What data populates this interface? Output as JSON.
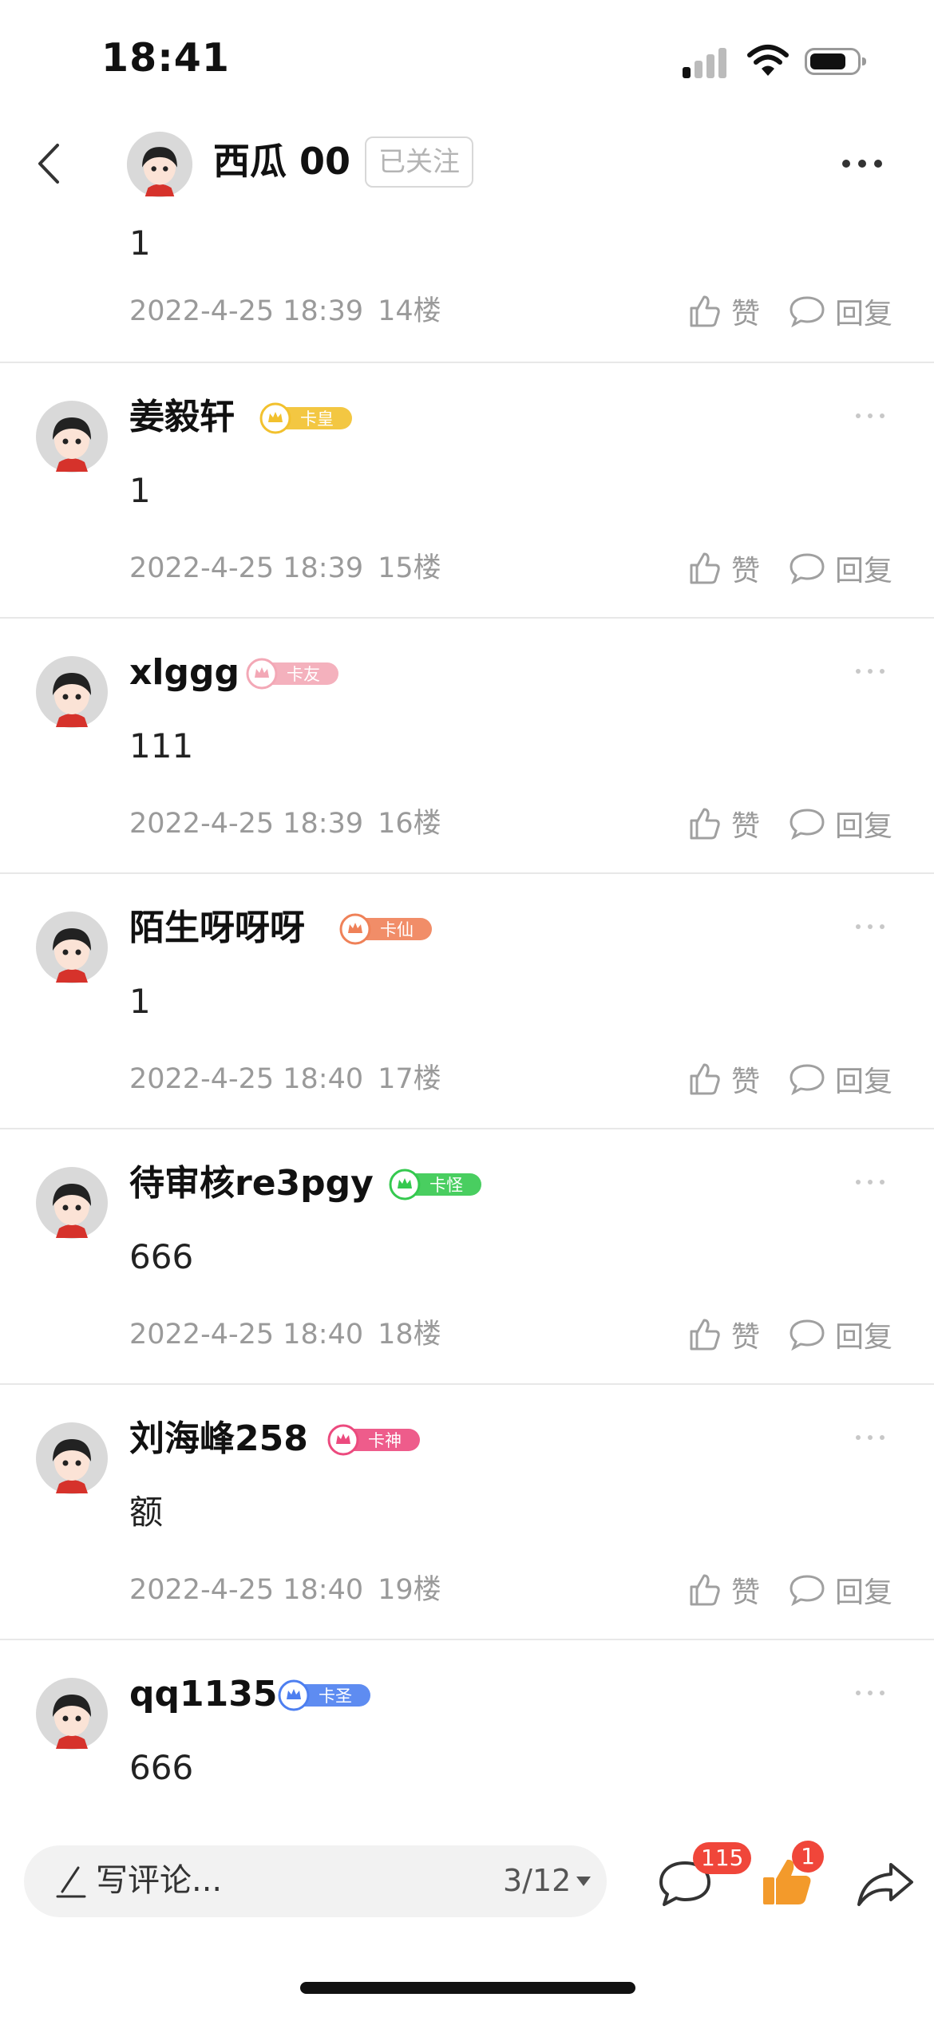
{
  "status": {
    "time": "18:41"
  },
  "header": {
    "user": "西瓜 00",
    "follow_label": "已关注"
  },
  "partial_comment": {
    "content": "1",
    "date": "2022-4-25 18:39",
    "floor": "14楼"
  },
  "actions": {
    "like": "赞",
    "reply": "回复"
  },
  "comments": [
    {
      "name": "姜毅轩",
      "badge": "卡皇",
      "badge_color": "#f2c12e",
      "content": "1",
      "date": "2022-4-25 18:39",
      "floor": "15楼"
    },
    {
      "name": "xlggg",
      "badge": "卡友",
      "badge_color": "#f3a8b6",
      "content": "111",
      "date": "2022-4-25 18:39",
      "floor": "16楼"
    },
    {
      "name": "陌生呀呀呀",
      "badge": "卡仙",
      "badge_color": "#ef8158",
      "content": "1",
      "date": "2022-4-25 18:40",
      "floor": "17楼"
    },
    {
      "name": "待审核re3pgy",
      "badge": "卡怪",
      "badge_color": "#35c94f",
      "content": "666",
      "date": "2022-4-25 18:40",
      "floor": "18楼"
    },
    {
      "name": "刘海峰258",
      "badge": "卡神",
      "badge_color": "#ec4a7e",
      "content": "额",
      "date": "2022-4-25 18:40",
      "floor": "19楼"
    },
    {
      "name": "qq1135",
      "badge": "卡圣",
      "badge_color": "#4d7ff0",
      "content": "666",
      "date": "",
      "floor": ""
    }
  ],
  "bottom_bar": {
    "placeholder": "写评论...",
    "page_indicator": "3/12",
    "comment_count": "115",
    "like_count": "1"
  },
  "colors": {
    "accent": "#f0463a",
    "like_active": "#f39a2b"
  },
  "icons": [
    "back-arrow-icon",
    "more-dots-icon",
    "thumbs-up-icon",
    "speech-bubble-icon",
    "pen-icon",
    "share-arrow-icon"
  ]
}
